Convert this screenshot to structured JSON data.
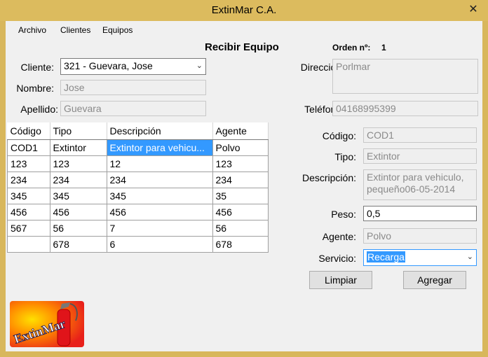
{
  "window": {
    "title": "ExtinMar C.A.",
    "close_glyph": "✕"
  },
  "menu": [
    "Archivo",
    "Clientes",
    "Equipos"
  ],
  "form": {
    "heading": "Recibir Equipo",
    "order_label": "Orden nº:",
    "order_value": "1",
    "cliente_label": "Cliente:",
    "cliente_value": "321 - Guevara, Jose",
    "nombre_label": "Nombre:",
    "nombre_value": "Jose",
    "apellido_label": "Apellido:",
    "apellido_value": "Guevara",
    "direccion_label": "Dirección:",
    "direccion_value": "Porlmar",
    "telefono_label": "Teléfono:",
    "telefono_value": "04168995399"
  },
  "table": {
    "columns": [
      "Código",
      "Tipo",
      "Descripción",
      "Agente"
    ],
    "rows": [
      [
        "COD1",
        "Extintor",
        "Extintor para vehicu...",
        "Polvo"
      ],
      [
        "123",
        "123",
        "12",
        "123"
      ],
      [
        "234",
        "234",
        "234",
        "234"
      ],
      [
        "345",
        "345",
        "345",
        "35"
      ],
      [
        "456",
        "456",
        "456",
        "456"
      ],
      [
        "567",
        "56",
        "7",
        "56"
      ],
      [
        "",
        "678",
        "6",
        "678"
      ]
    ]
  },
  "detail": {
    "codigo_label": "Código:",
    "codigo_value": "COD1",
    "tipo_label": "Tipo:",
    "tipo_value": "Extintor",
    "descripcion_label": "Descripción:",
    "descripcion_line1": "Extintor para vehiculo,",
    "descripcion_line2": "pequeño06-05-2014",
    "peso_label": "Peso:",
    "peso_value": "0,5",
    "agente_label": "Agente:",
    "agente_value": "Polvo",
    "servicio_label": "Servicio:",
    "servicio_value": "Recarga"
  },
  "buttons": {
    "limpiar": "Limpiar",
    "agregar": "Agregar"
  },
  "logo": {
    "text": "ExtinMar",
    "icon": "fire-extinguisher-icon"
  },
  "colors": {
    "frame": "#d8b75c",
    "selection": "#3399ff",
    "logo_red": "#e8201a",
    "logo_yellow": "#f7d000"
  }
}
